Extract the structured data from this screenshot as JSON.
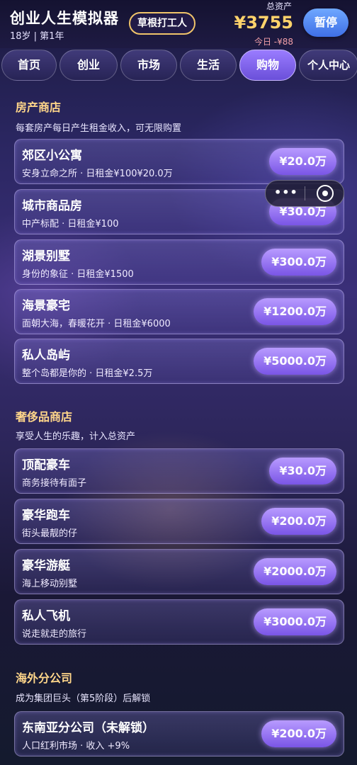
{
  "header": {
    "title": "创业人生模拟器",
    "age_info": "18岁 | 第1年",
    "rank": "草根打工人",
    "assets_label": "总资产",
    "assets_value": "¥3755",
    "today_value": "今日 -¥88",
    "pause_label": "暂停"
  },
  "tabs": [
    {
      "label": "首页",
      "active": false
    },
    {
      "label": "创业",
      "active": false
    },
    {
      "label": "市场",
      "active": false
    },
    {
      "label": "生活",
      "active": false
    },
    {
      "label": "购物",
      "active": true
    },
    {
      "label": "个人中心",
      "active": false
    }
  ],
  "capsule": {
    "more_icon": "more-dots-icon",
    "close_icon": "close-circle-icon"
  },
  "sections": {
    "property": {
      "title": "房产商店",
      "desc": "每套房产每日产生租金收入，可无限购置",
      "items": [
        {
          "name": "郊区小公寓",
          "desc": "安身立命之所 · 日租金¥100¥20.0万",
          "price": "¥20.0万"
        },
        {
          "name": "城市商品房",
          "desc": "中产标配 · 日租金¥100",
          "price": "¥30.0万"
        },
        {
          "name": "湖景别墅",
          "desc": "身份的象征 · 日租金¥1500",
          "price": "¥300.0万"
        },
        {
          "name": "海景豪宅",
          "desc": "面朝大海，春暖花开 · 日租金¥6000",
          "price": "¥1200.0万"
        },
        {
          "name": "私人岛屿",
          "desc": "整个岛都是你的 · 日租金¥2.5万",
          "price": "¥5000.0万"
        }
      ]
    },
    "luxury": {
      "title": "奢侈品商店",
      "desc": "享受人生的乐趣，计入总资产",
      "items": [
        {
          "name": "顶配豪车",
          "desc": "商务接待有面子",
          "price": "¥30.0万"
        },
        {
          "name": "豪华跑车",
          "desc": "街头最靓的仔",
          "price": "¥200.0万"
        },
        {
          "name": "豪华游艇",
          "desc": "海上移动别墅",
          "price": "¥2000.0万"
        },
        {
          "name": "私人飞机",
          "desc": "说走就走的旅行",
          "price": "¥3000.0万"
        }
      ]
    },
    "overseas": {
      "title": "海外分公司",
      "desc": "成为集团巨头（第5阶段）后解锁",
      "items": [
        {
          "name": "东南亚分公司（未解锁）",
          "desc": "人口红利市场 · 收入 +9%",
          "price": "¥200.0万"
        }
      ]
    }
  }
}
